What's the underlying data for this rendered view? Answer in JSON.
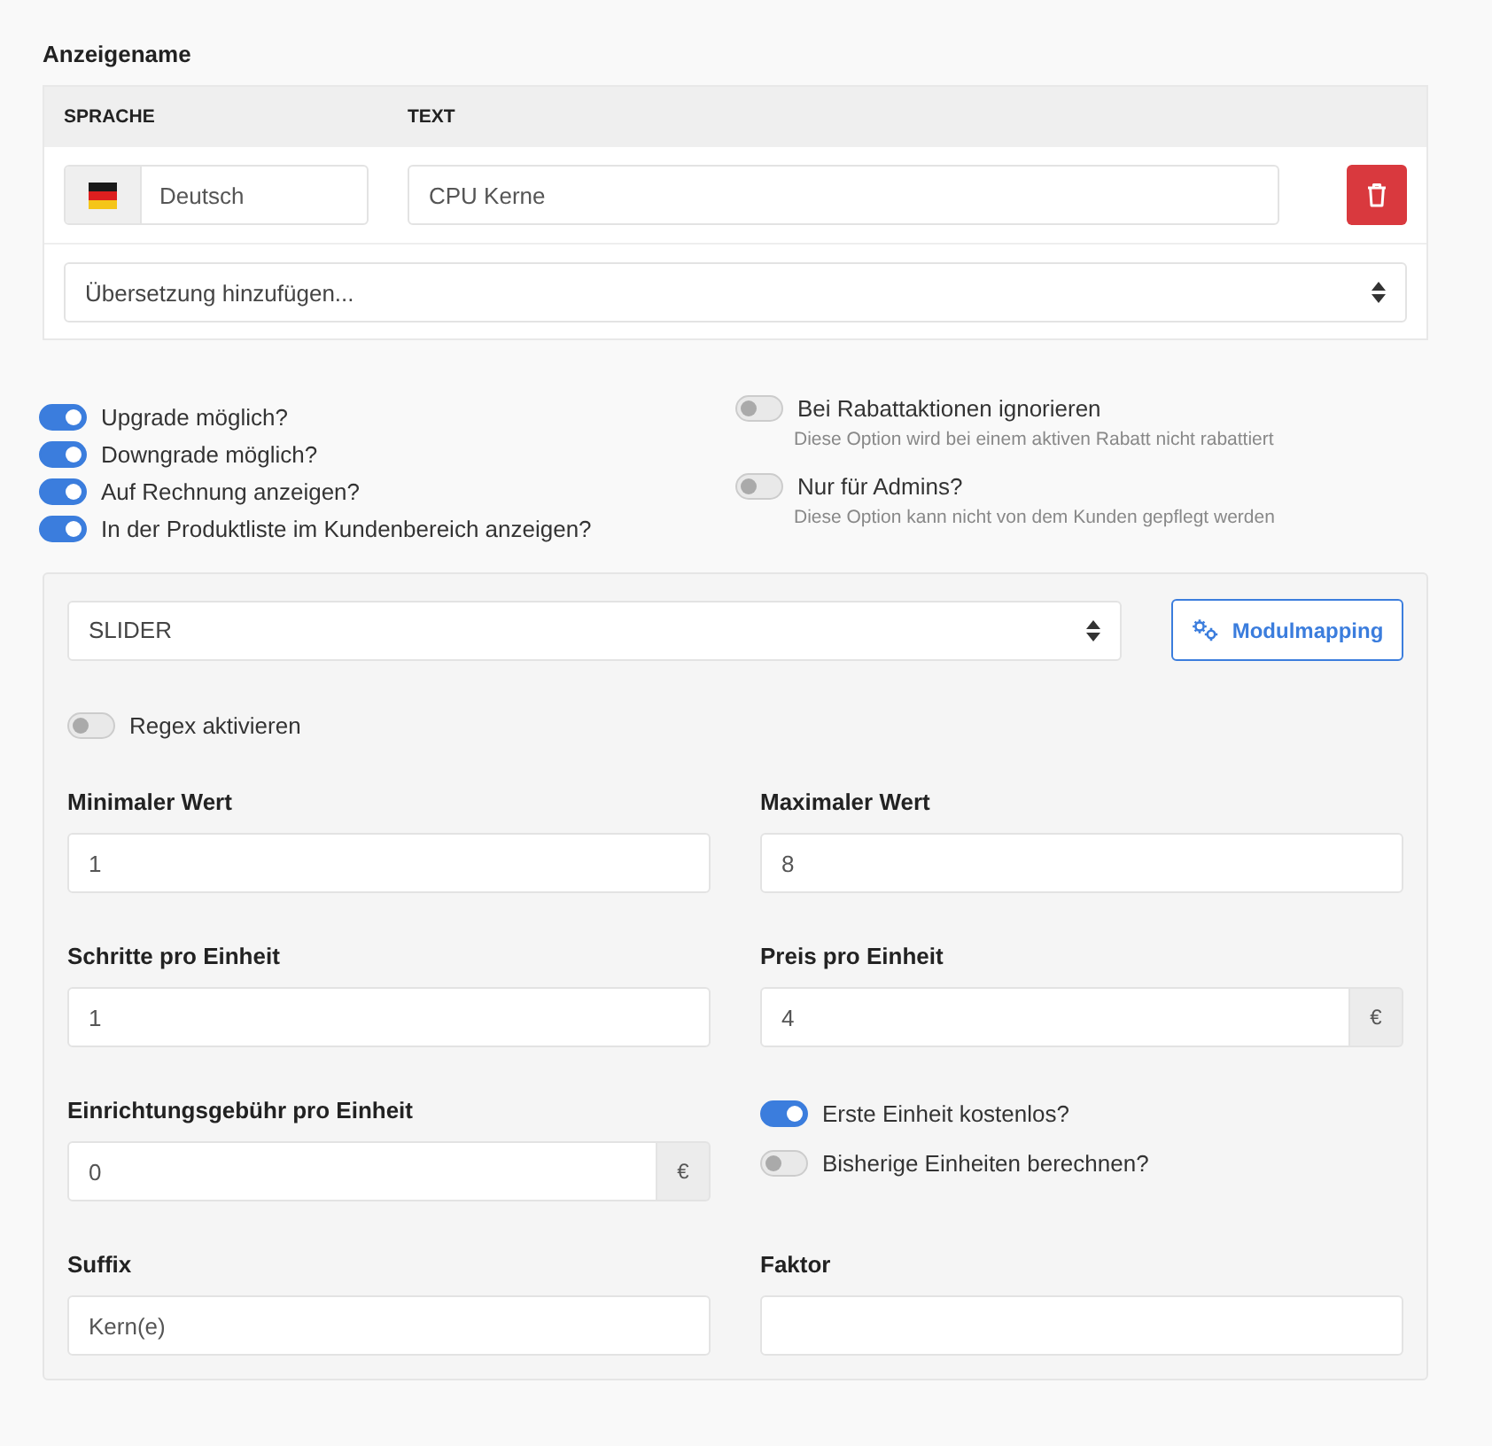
{
  "display_name": {
    "label": "Anzeigename",
    "columns": [
      "SPRACHE",
      "TEXT"
    ],
    "rows": [
      {
        "language": "Deutsch",
        "text": "CPU Kerne"
      }
    ],
    "add_select": {
      "value": "Übersetzung hinzufügen..."
    }
  },
  "options_left": [
    {
      "label": "Upgrade möglich?",
      "on": true
    },
    {
      "label": "Downgrade möglich?",
      "on": true
    },
    {
      "label": "Auf Rechnung anzeigen?",
      "on": true
    },
    {
      "label": "In der Produktliste im Kundenbereich anzeigen?",
      "on": true
    }
  ],
  "options_right": [
    {
      "label": "Bei Rabattaktionen ignorieren",
      "on": false,
      "hint": "Diese Option wird bei einem aktiven Rabatt nicht rabattiert"
    },
    {
      "label": "Nur für Admins?",
      "on": false,
      "hint": "Diese Option kann nicht von dem Kunden gepflegt werden"
    }
  ],
  "config": {
    "type_select": {
      "value": "SLIDER"
    },
    "mapping_button": "Modulmapping",
    "regex": {
      "label": "Regex aktivieren",
      "on": false
    },
    "fields": [
      {
        "kind": "input",
        "label": "Minimaler Wert",
        "value": "1"
      },
      {
        "kind": "input",
        "label": "Maximaler Wert",
        "value": "8"
      },
      {
        "kind": "input",
        "label": "Schritte pro Einheit",
        "value": "1"
      },
      {
        "kind": "input",
        "label": "Preis pro Einheit",
        "value": "4",
        "addon": "€"
      },
      {
        "kind": "input",
        "label": "Einrichtungsgebühr pro Einheit",
        "value": "0",
        "addon": "€"
      },
      {
        "kind": "toggles",
        "items": [
          {
            "label": "Erste Einheit kostenlos?",
            "on": true
          },
          {
            "label": "Bisherige Einheiten berechnen?",
            "on": false
          }
        ]
      },
      {
        "kind": "input",
        "label": "Suffix",
        "value": "Kern(e)"
      },
      {
        "kind": "input",
        "label": "Faktor"
      }
    ]
  }
}
